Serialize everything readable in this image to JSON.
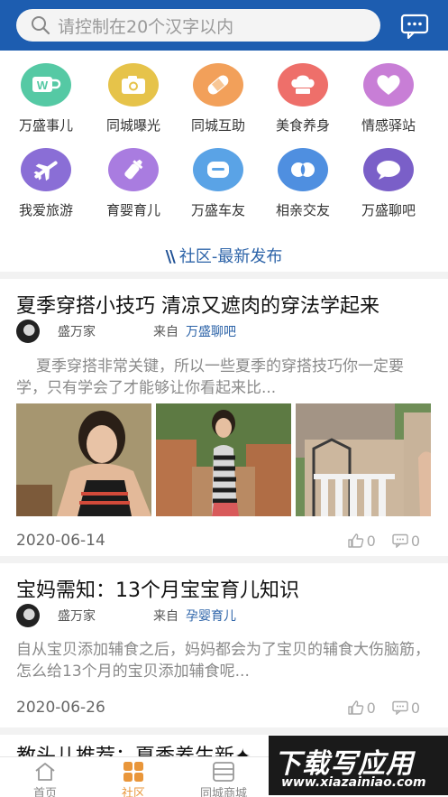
{
  "header": {
    "search_placeholder": "请控制在20个汉字以内",
    "search_icon": "search-icon",
    "message_icon": "chat-bubble-icon",
    "bg_color": "#1d5db0"
  },
  "categories": [
    {
      "label": "万盛事儿",
      "icon": "cup-w-icon",
      "color": "#55c9a4"
    },
    {
      "label": "同城曝光",
      "icon": "camera-icon",
      "color": "#e6c34a"
    },
    {
      "label": "同城互助",
      "icon": "bandage-icon",
      "color": "#f2a05a"
    },
    {
      "label": "美食养身",
      "icon": "chef-hat-icon",
      "color": "#ee6f6a"
    },
    {
      "label": "情感驿站",
      "icon": "heart-icon",
      "color": "#c87ed6"
    },
    {
      "label": "我爱旅游",
      "icon": "airplane-icon",
      "color": "#8a6ed6"
    },
    {
      "label": "育婴育儿",
      "icon": "baby-bottle-icon",
      "color": "#a97ce0"
    },
    {
      "label": "万盛车友",
      "icon": "car-icon",
      "color": "#5aa3e6"
    },
    {
      "label": "相亲交友",
      "icon": "couple-icon",
      "color": "#4f8fe0"
    },
    {
      "label": "万盛聊吧",
      "icon": "speech-bubble-icon",
      "color": "#7a5fc8"
    }
  ],
  "section_title": "社区-最新发布",
  "posts": [
    {
      "title": "夏季穿搭小技巧 清凉又遮肉的穿法学起来",
      "author": "盛万家",
      "from_label": "来自",
      "category": "万盛聊吧",
      "excerpt": "夏季穿搭非常关键，所以一些夏季的穿搭技巧你一定要学，只有学会了才能够让你看起来比...",
      "date": "2020-06-14",
      "likes": "0",
      "comments": "0"
    },
    {
      "title": "宝妈需知：13个月宝宝育儿知识",
      "author": "盛万家",
      "from_label": "来自",
      "category": "孕婴育儿",
      "excerpt": "自从宝贝添加辅食之后，妈妈都会为了宝贝的辅食大伤脑筋，怎么给13个月的宝贝添加辅食呢...",
      "date": "2020-06-26",
      "likes": "0",
      "comments": "0"
    }
  ],
  "partial_title": "教头儿推荐：夏季养生新✦",
  "tabs": [
    {
      "label": "首页",
      "icon": "home-icon",
      "active": false
    },
    {
      "label": "社区",
      "icon": "grid-icon",
      "active": true
    },
    {
      "label": "同城商城",
      "icon": "shop-icon",
      "active": false
    },
    {
      "label": "",
      "icon": "tab-icon",
      "active": false
    },
    {
      "label": "",
      "icon": "profile-icon",
      "active": false
    }
  ],
  "watermark": {
    "big": "下载写应用",
    "small": "www.xiazainiao.com"
  },
  "accent_color": "#e9963a"
}
